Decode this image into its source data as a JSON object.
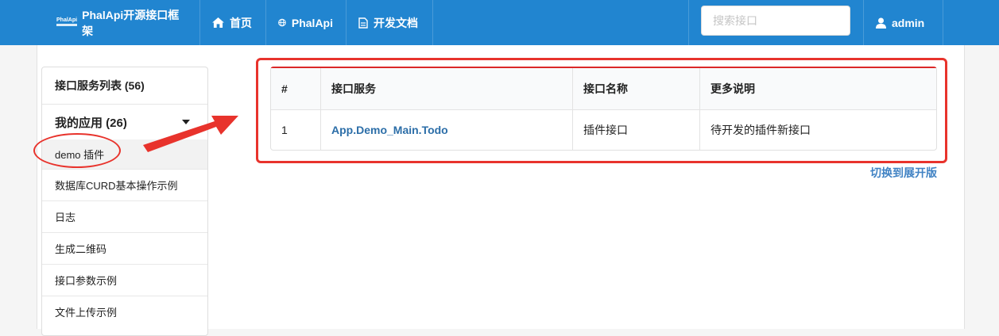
{
  "navbar": {
    "logo_small": "PhalApi",
    "brand": "PhalApi开源接口框架",
    "items": [
      {
        "label": "首页",
        "icon": "home-icon"
      },
      {
        "label": "PhalApi",
        "icon": "globe-icon"
      },
      {
        "label": "开发文档",
        "icon": "document-icon"
      }
    ],
    "search": {
      "placeholder": "搜索接口",
      "value": ""
    },
    "user": {
      "label": "admin",
      "icon": "user-icon"
    }
  },
  "sidebar": {
    "header": "接口服务列表 (56)",
    "group": "我的应用 (26)",
    "items": [
      {
        "label": "demo 插件"
      },
      {
        "label": "数据库CURD基本操作示例"
      },
      {
        "label": "日志"
      },
      {
        "label": "生成二维码"
      },
      {
        "label": "接口参数示例"
      },
      {
        "label": "文件上传示例"
      }
    ]
  },
  "table": {
    "columns": [
      "#",
      "接口服务",
      "接口名称",
      "更多说明"
    ],
    "rows": [
      {
        "index": "1",
        "service": "App.Demo_Main.Todo",
        "name": "插件接口",
        "desc": "待开发的插件新接口"
      }
    ]
  },
  "toggle_link": "切换到展开版",
  "colors": {
    "navbar": "#2185d0",
    "link": "#2c6ea8",
    "annotation": "#e8332c",
    "table_top_border": "#db2828"
  }
}
